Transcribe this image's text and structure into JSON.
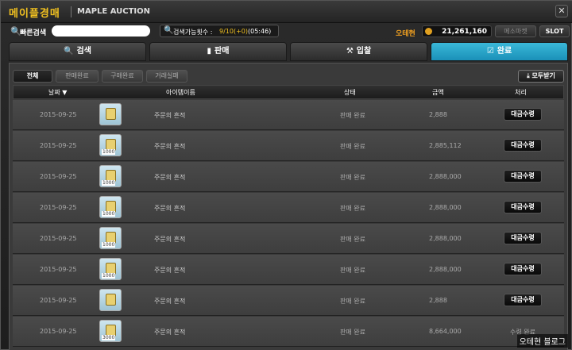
{
  "window": {
    "title_ko": "메이플경매",
    "title_en": "MAPLE AUCTION",
    "close": "✕"
  },
  "searchbar": {
    "quick_search_label": "빠른검색",
    "quick_search_value": "",
    "search_count_label": "검색가능횟수 :",
    "search_count_value": "9/10(+0)",
    "search_count_time": "(05:46)",
    "currency_label": "오테현",
    "currency_value": "21,261,160",
    "cart_label": "메소마켓",
    "slot_label": "SLOT"
  },
  "tabs": [
    {
      "label": "검색",
      "icon": "🔍"
    },
    {
      "label": "판매",
      "icon": "▮"
    },
    {
      "label": "입찰",
      "icon": "⚒"
    },
    {
      "label": "완료",
      "icon": "☑"
    }
  ],
  "subtabs": [
    "전체",
    "판매완료",
    "구매완료",
    "거래실패"
  ],
  "receive_all": "모두받기",
  "columns": {
    "date": "날짜 ▼",
    "item_name": "아이템이름",
    "status": "상태",
    "price": "금액",
    "action": "처리"
  },
  "rows": [
    {
      "date": "2015-09-25",
      "item": "주문의 흔적",
      "qty": "",
      "status": "판매 완료",
      "price": "2,888",
      "action": "대금수령"
    },
    {
      "date": "2015-09-25",
      "item": "주문의 흔적",
      "qty": "1000",
      "status": "판매 완료",
      "price": "2,885,112",
      "action": "대금수령"
    },
    {
      "date": "2015-09-25",
      "item": "주문의 흔적",
      "qty": "1000",
      "status": "판매 완료",
      "price": "2,888,000",
      "action": "대금수령"
    },
    {
      "date": "2015-09-25",
      "item": "주문의 흔적",
      "qty": "1000",
      "status": "판매 완료",
      "price": "2,888,000",
      "action": "대금수령"
    },
    {
      "date": "2015-09-25",
      "item": "주문의 흔적",
      "qty": "1000",
      "status": "판매 완료",
      "price": "2,888,000",
      "action": "대금수령"
    },
    {
      "date": "2015-09-25",
      "item": "주문의 흔적",
      "qty": "1000",
      "status": "판매 완료",
      "price": "2,888,000",
      "action": "대금수령"
    },
    {
      "date": "2015-09-25",
      "item": "주문의 흔적",
      "qty": "",
      "status": "판매 완료",
      "price": "2,888",
      "action": "대금수령"
    },
    {
      "date": "2015-09-25",
      "item": "주문의 흔적",
      "qty": "3000",
      "status": "판매 완료",
      "price": "8,664,000",
      "action": "수령 완료"
    }
  ],
  "watermark": "오테현 블로그",
  "colors": {
    "accent_tab": "#2aa8cc",
    "title_gold": "#f0c020"
  }
}
